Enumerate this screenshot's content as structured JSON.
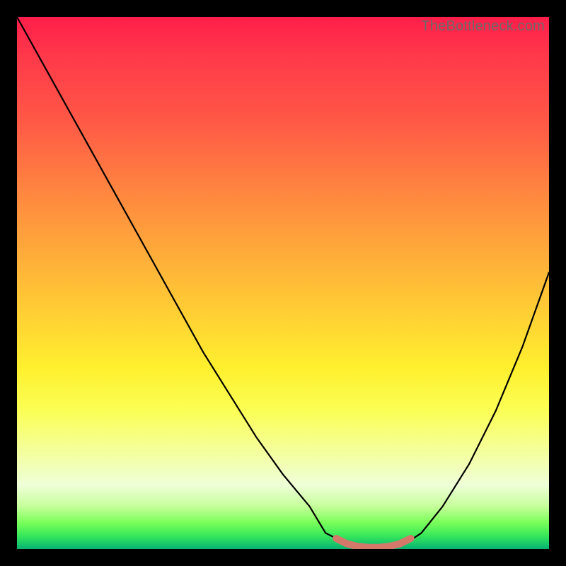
{
  "attribution": "TheBottleneck.com",
  "chart_data": {
    "type": "line",
    "title": "",
    "xlabel": "",
    "ylabel": "",
    "xlim": [
      0,
      100
    ],
    "ylim": [
      0,
      100
    ],
    "series": [
      {
        "name": "bottleneck-curve",
        "x": [
          0,
          5,
          10,
          15,
          20,
          25,
          30,
          35,
          40,
          45,
          50,
          55,
          58,
          62,
          66,
          70,
          73,
          76,
          80,
          85,
          90,
          95,
          100
        ],
        "y": [
          100,
          91,
          82,
          73,
          64,
          55,
          46,
          37,
          29,
          21,
          14,
          8,
          3,
          1,
          0,
          0,
          1,
          3,
          8,
          16,
          26,
          38,
          52
        ]
      },
      {
        "name": "optimal-marker",
        "x": [
          60,
          62,
          64,
          66,
          68,
          70,
          72,
          74
        ],
        "y": [
          2,
          1,
          0.5,
          0.3,
          0.3,
          0.5,
          1,
          2
        ]
      }
    ],
    "colors": {
      "bottleneck-curve": "#000000",
      "optimal-marker": "#d4786a"
    }
  }
}
